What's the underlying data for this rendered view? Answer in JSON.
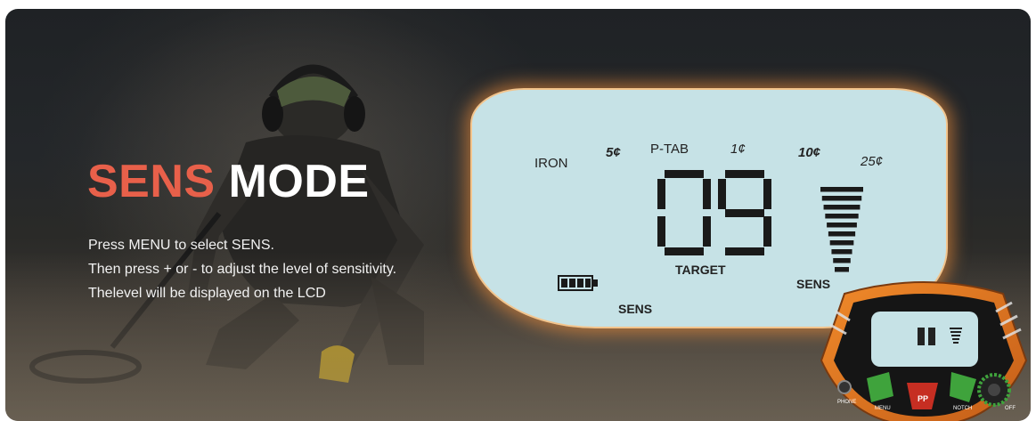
{
  "banner": {
    "title_accent": "SENS",
    "title_rest": " MODE",
    "lines": [
      "Press MENU to select SENS.",
      "Then press + or - to adjust the level of sensitivity.",
      "Thelevel will be displayed on the LCD"
    ]
  },
  "lcd": {
    "labels": {
      "iron": "IRON",
      "five": "5¢",
      "ptab": "P-TAB",
      "one": "1¢",
      "ten": "10¢",
      "twentyfive": "25¢",
      "target": "TARGET",
      "sens_right": "SENS",
      "sens_bottom": "SENS"
    },
    "reading": "09",
    "battery_level": 1.0,
    "sens_bars": 10
  },
  "colors": {
    "accent": "#e8604a",
    "lcd_bg": "#c6e2e6",
    "glow": "#ff9640"
  },
  "device": {
    "labels": {
      "phone": "PHONE",
      "menu": "MENU",
      "notch": "NOTCH",
      "off": "OFF",
      "pp": "PP"
    }
  }
}
